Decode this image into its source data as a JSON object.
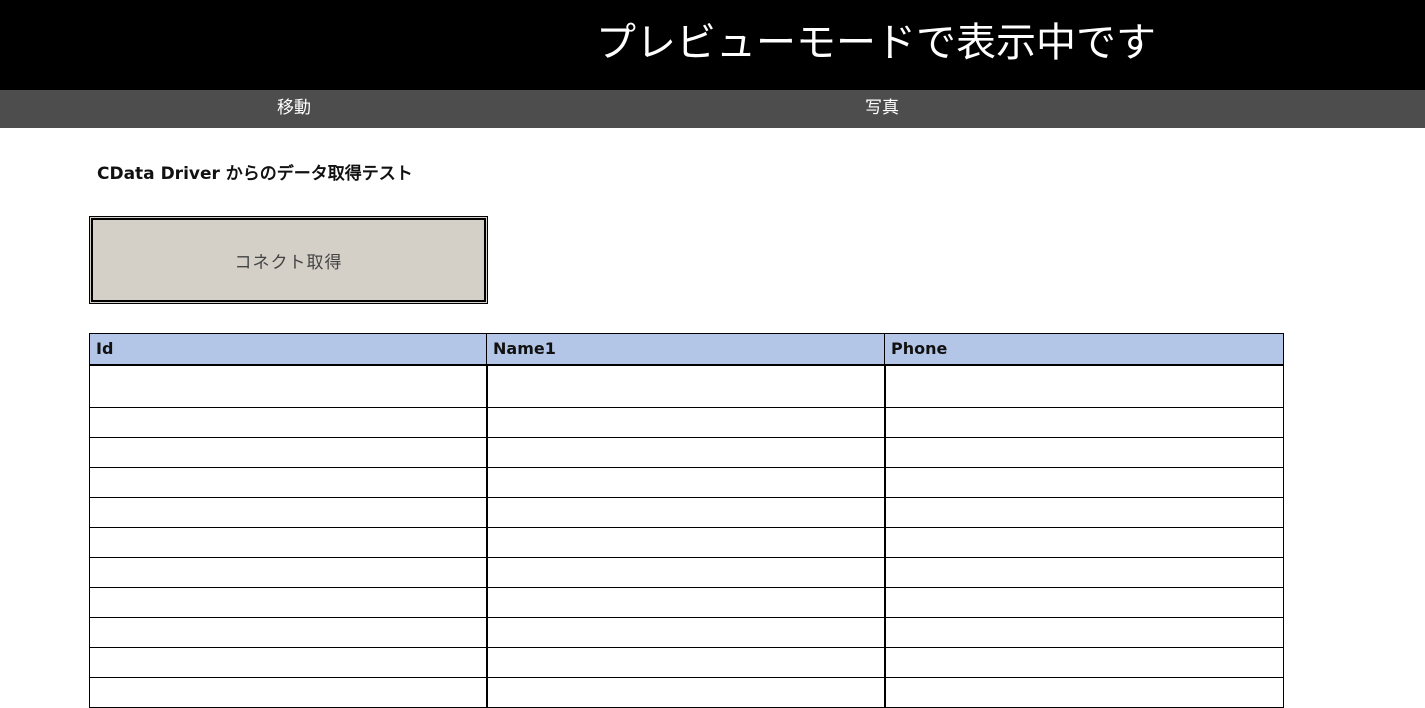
{
  "banner": {
    "text": "プレビューモードで表示中です"
  },
  "nav": {
    "items": [
      {
        "label": "移動"
      },
      {
        "label": "写真"
      }
    ]
  },
  "page": {
    "heading": "CData Driver からのデータ取得テスト"
  },
  "connect_button": {
    "label": "コネクト取得"
  },
  "table": {
    "columns": [
      "Id",
      "Name1",
      "Phone"
    ],
    "rows": [
      [
        "",
        "",
        ""
      ],
      [
        "",
        "",
        ""
      ],
      [
        "",
        "",
        ""
      ],
      [
        "",
        "",
        ""
      ],
      [
        "",
        "",
        ""
      ],
      [
        "",
        "",
        ""
      ],
      [
        "",
        "",
        ""
      ],
      [
        "",
        "",
        ""
      ],
      [
        "",
        "",
        ""
      ],
      [
        "",
        "",
        ""
      ],
      [
        "",
        "",
        ""
      ]
    ]
  },
  "colors": {
    "banner_bg": "#000000",
    "nav_bg": "#4d4d4d",
    "header_bg": "#b4c6e7",
    "button_bg": "#d4d0c8"
  }
}
